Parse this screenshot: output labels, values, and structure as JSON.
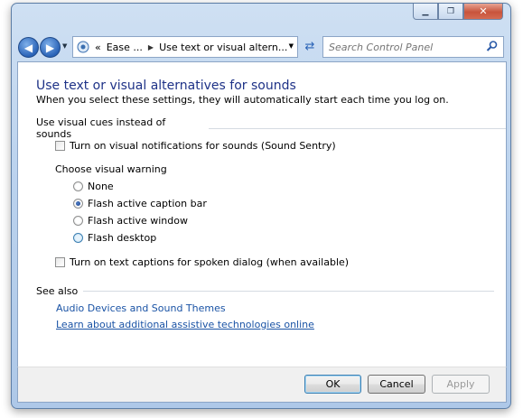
{
  "window": {
    "minimize_glyph": "▁",
    "maximize_glyph": "❐",
    "close_glyph": "✕"
  },
  "navbar": {
    "breadcrumb_overflow": "«",
    "breadcrumb_parent": "Ease ...",
    "breadcrumb_separator": "▶",
    "breadcrumb_current": "Use text or visual altern...",
    "search_placeholder": "Search Control Panel"
  },
  "page": {
    "title": "Use text or visual alternatives for sounds",
    "subtitle": "When you select these settings, they will automatically start each time you log on.",
    "section_visual_cues": "Use visual cues instead of sounds",
    "sound_sentry_label": "Turn on visual notifications for sounds (Sound Sentry)",
    "sound_sentry_checked": false,
    "choose_warning_label": "Choose visual warning",
    "warning_options": [
      {
        "label": "None",
        "selected": false
      },
      {
        "label": "Flash active caption bar",
        "selected": true
      },
      {
        "label": "Flash active window",
        "selected": false
      },
      {
        "label": "Flash desktop",
        "selected": false
      }
    ],
    "text_captions_label": "Turn on text captions for spoken dialog (when available)",
    "text_captions_checked": false,
    "see_also_label": "See also",
    "link_audio_devices": "Audio Devices and Sound Themes",
    "link_assistive_tech": "Learn about additional assistive technologies online"
  },
  "footer": {
    "ok_label": "OK",
    "cancel_label": "Cancel",
    "apply_label": "Apply"
  },
  "icons": {
    "back": "back-arrow-icon",
    "forward": "forward-arrow-icon",
    "refresh": "refresh-icon",
    "search": "search-icon",
    "control_panel": "control-panel-icon"
  },
  "colors": {
    "title": "#1e3287",
    "link": "#1a53a5",
    "frame": "#aec8e8"
  }
}
